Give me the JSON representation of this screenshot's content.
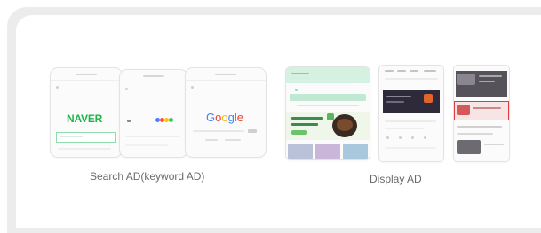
{
  "search_ad": {
    "caption": "Search AD(keyword AD)",
    "phones": [
      {
        "logo": "NAVER",
        "logo_color": "#21b34b"
      },
      {
        "logo": "daum"
      },
      {
        "logo": "Google"
      }
    ]
  },
  "display_ad": {
    "caption": "Display AD"
  },
  "colors": {
    "panel": "#ececec",
    "naver_green": "#21b34b",
    "mint_header": "#9ee0c0",
    "ad_highlight": "#e23b3b",
    "dark_banner": "#2e2a3a"
  }
}
